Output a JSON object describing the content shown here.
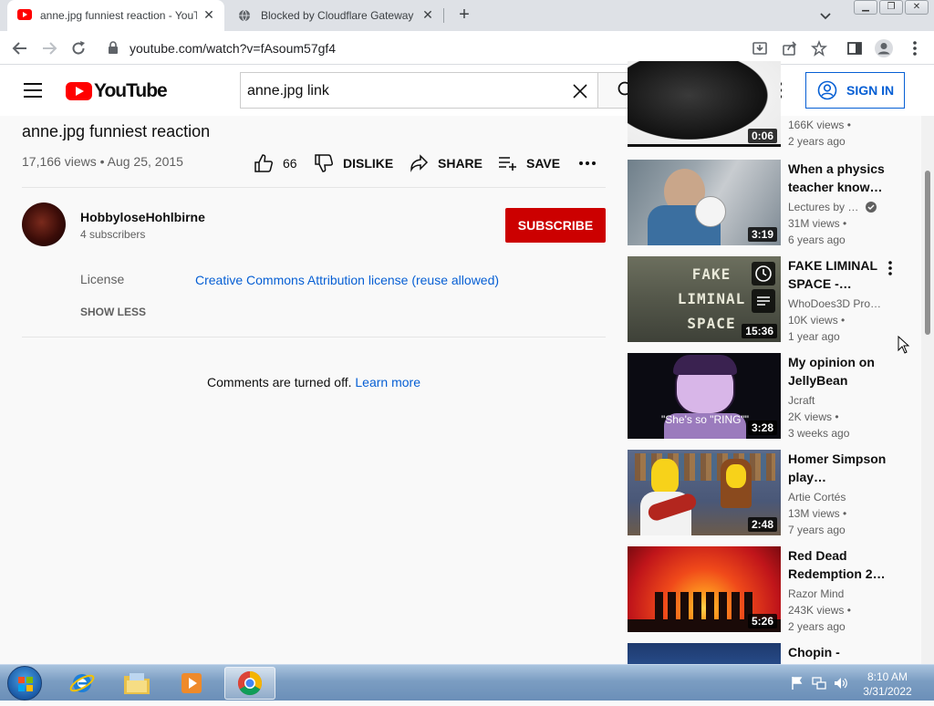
{
  "browser": {
    "tabs": [
      {
        "title": "anne.jpg funniest reaction - YouTube",
        "active": true
      },
      {
        "title": "Blocked by Cloudflare Gateway",
        "active": false
      }
    ],
    "url": "youtube.com/watch?v=fAsoum57gf4"
  },
  "yt": {
    "logo": "YouTube",
    "search_query": "anne.jpg link",
    "signin_label": "SIGN IN"
  },
  "video": {
    "title": "anne.jpg funniest reaction",
    "meta": "17,166 views • Aug 25, 2015",
    "likes": "66",
    "dislike_label": "DISLIKE",
    "share_label": "SHARE",
    "save_label": "SAVE",
    "channel": "HobbyloseHohlbirne",
    "subscribers": "4 subscribers",
    "subscribe_label": "SUBSCRIBE",
    "license_label": "License",
    "license_value": "Creative Commons Attribution license (reuse allowed)",
    "show_less": "SHOW LESS",
    "comments_text": "Comments are turned off.",
    "comments_link": "Learn more"
  },
  "recommendations": [
    {
      "title": "",
      "channel": "",
      "views": "166K views •",
      "age": "2 years ago",
      "duration": "0:06"
    },
    {
      "title": "When a physics teacher know…",
      "channel": "Lectures by …",
      "views": "31M views •",
      "age": "6 years ago",
      "duration": "3:19",
      "verified": true
    },
    {
      "title": "FAKE LIMINAL SPACE -…",
      "channel": "WhoDoes3D Pro…",
      "views": "10K views •",
      "age": "1 year ago",
      "duration": "15:36",
      "thumb_text": "FAKE LIMINAL SPACE"
    },
    {
      "title": "My opinion on JellyBean",
      "channel": "Jcraft",
      "views": "2K views •",
      "age": "3 weeks ago",
      "duration": "3:28",
      "thumb_caption": "\"She's so \"RING\"\""
    },
    {
      "title": "Homer Simpson play…",
      "channel": "Artie Cortés",
      "views": "13M views •",
      "age": "7 years ago",
      "duration": "2:48"
    },
    {
      "title": "Red Dead Redemption 2…",
      "channel": "Razor Mind",
      "views": "243K views •",
      "age": "2 years ago",
      "duration": "5:26"
    },
    {
      "title": "Chopin -",
      "channel": "",
      "views": "",
      "age": "",
      "duration": ""
    }
  ],
  "taskbar": {
    "time": "8:10 AM",
    "date": "3/31/2022"
  }
}
